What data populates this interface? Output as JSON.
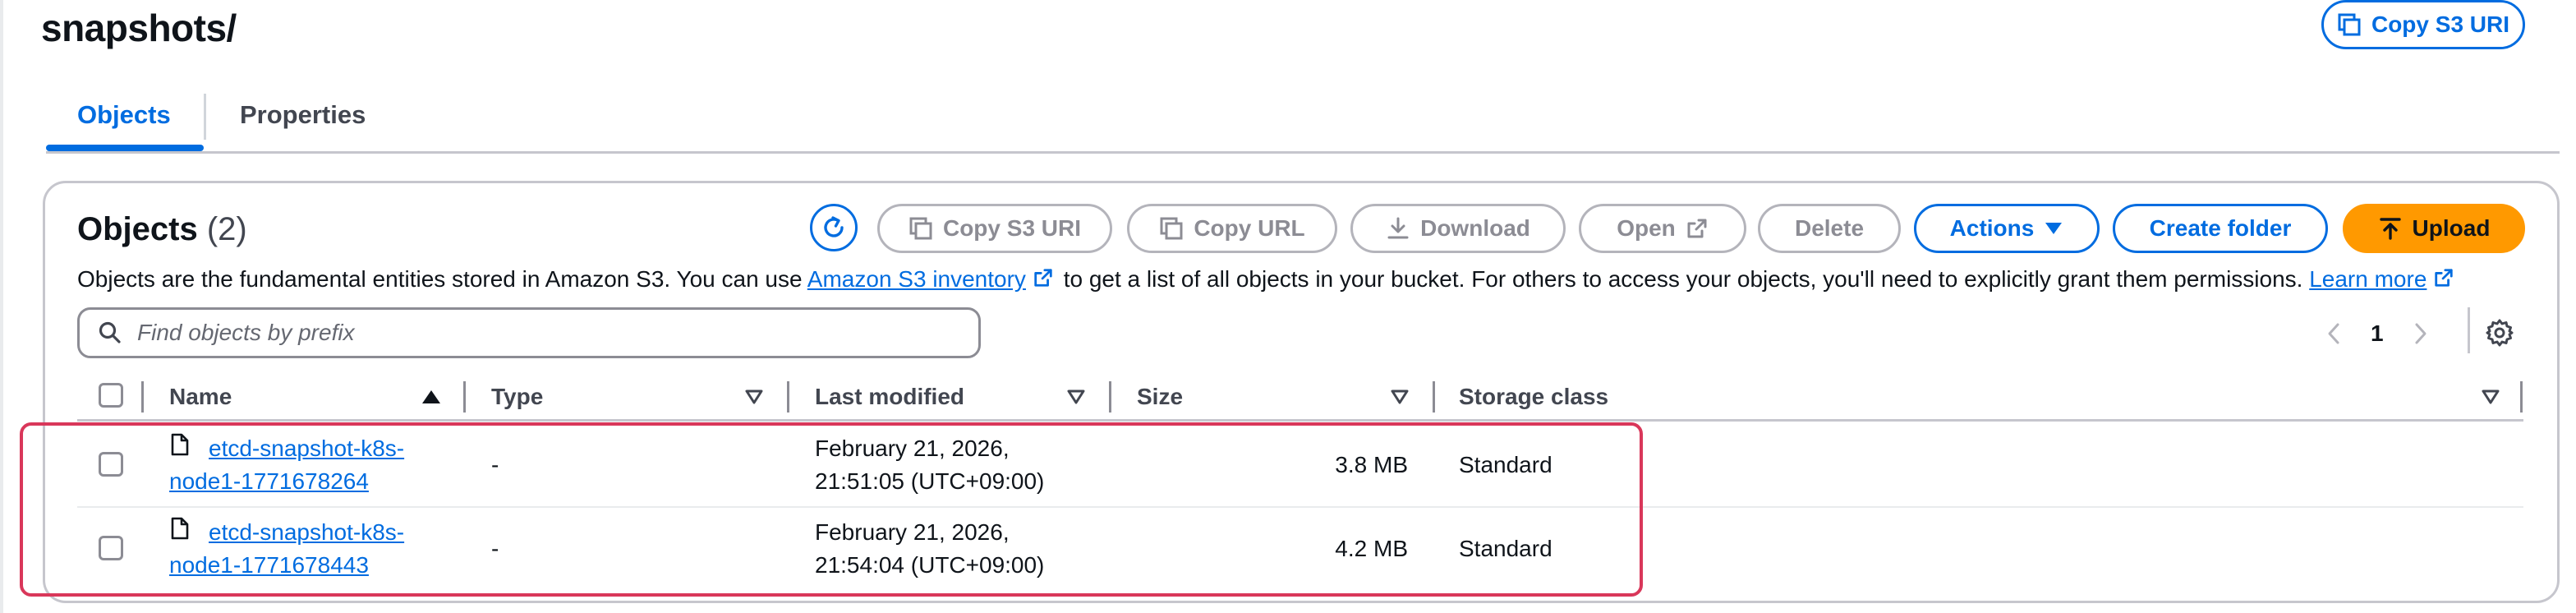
{
  "page": {
    "title": "snapshots/",
    "copy_s3_uri_label": "Copy S3 URI"
  },
  "tabs": [
    {
      "label": "Objects",
      "active": true
    },
    {
      "label": "Properties",
      "active": false
    }
  ],
  "objects_panel": {
    "heading": "Objects",
    "count": "(2)",
    "buttons": {
      "copy_s3_uri": "Copy S3 URI",
      "copy_url": "Copy URL",
      "download": "Download",
      "open": "Open",
      "delete": "Delete",
      "actions": "Actions",
      "create_folder": "Create folder",
      "upload": "Upload"
    },
    "description": {
      "part1": "Objects are the fundamental entities stored in Amazon S3. You can use ",
      "link1": "Amazon S3 inventory",
      "part2": " to get a list of all objects in your bucket. For others to access your objects, you'll need to explicitly grant them permissions. ",
      "link2": "Learn more"
    },
    "search": {
      "placeholder": "Find objects by prefix",
      "value": ""
    },
    "pagination": {
      "current_page": "1"
    },
    "table": {
      "columns": [
        "Name",
        "Type",
        "Last modified",
        "Size",
        "Storage class"
      ],
      "rows": [
        {
          "name_line1": "etcd-snapshot-k8s-",
          "name_line2": "node1-1771678264",
          "type": "-",
          "modified_line1": "February 21, 2026,",
          "modified_line2": "21:51:05 (UTC+09:00)",
          "size": "3.8 MB",
          "storage_class": "Standard"
        },
        {
          "name_line1": "etcd-snapshot-k8s-",
          "name_line2": "node1-1771678443",
          "type": "-",
          "modified_line1": "February 21, 2026,",
          "modified_line2": "21:54:04 (UTC+09:00)",
          "size": "4.2 MB",
          "storage_class": "Standard"
        }
      ]
    }
  },
  "colors": {
    "accent": "#006ce0",
    "upload": "#ff9900",
    "highlight": "#d9375a",
    "disabled": "#8c8c94"
  }
}
